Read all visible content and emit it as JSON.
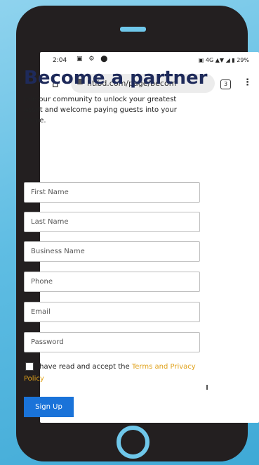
{
  "status_bar": {
    "time": "2:04",
    "icons_left": "▣ ⚙ ⬤",
    "right": "▣ 4G ▲▼ ◢ ▮ 29%"
  },
  "browser": {
    "url": "htlbd.com/page/becom",
    "tab_count": "3"
  },
  "page": {
    "title": "Become a partner",
    "subtitle": "Join our community to unlock your greatest asset and welcome paying guests into your home."
  },
  "form": {
    "first_name_placeholder": "First Name",
    "last_name_placeholder": "Last Name",
    "business_name_placeholder": "Business Name",
    "phone_placeholder": "Phone",
    "email_placeholder": "Email",
    "password_placeholder": "Password",
    "agree_text": "I have read and accept the ",
    "terms_link": "Terms and Privacy Policy",
    "signup_label": "Sign Up"
  },
  "colors": {
    "title": "#1e2a5a",
    "link": "#e0a21b",
    "button": "#1a73d9",
    "phone_body": "#231f20",
    "background": "#5fbde3"
  }
}
